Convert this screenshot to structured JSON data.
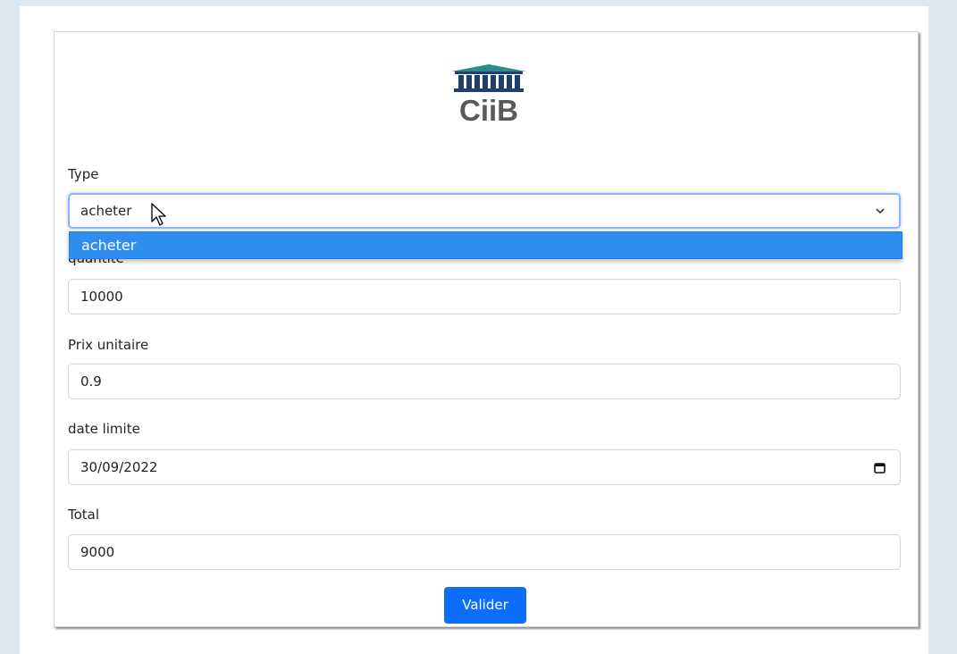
{
  "logo": {
    "text": "CiiB"
  },
  "form": {
    "type": {
      "label": "Type",
      "value": "acheter",
      "options": [
        "acheter"
      ],
      "highlighted_option": "acheter"
    },
    "quantite": {
      "label": "quantite",
      "value": "10000"
    },
    "prix_unitaire": {
      "label": "Prix unitaire",
      "value": "0.9"
    },
    "date_limite": {
      "label": "date limite",
      "value": "30/09/2022"
    },
    "total": {
      "label": "Total",
      "value": "9000"
    },
    "submit_label": "Valider"
  },
  "colors": {
    "page_background": "#dfe7f0",
    "primary": "#0d6efd",
    "dropdown_highlight": "#2f8ff0",
    "logo_teal": "#2a8c8e",
    "logo_navy": "#1f3f6e"
  },
  "icons": {
    "select_caret": "chevron-down-icon",
    "date_picker": "calendar-icon",
    "pointer": "mouse-cursor-icon"
  }
}
